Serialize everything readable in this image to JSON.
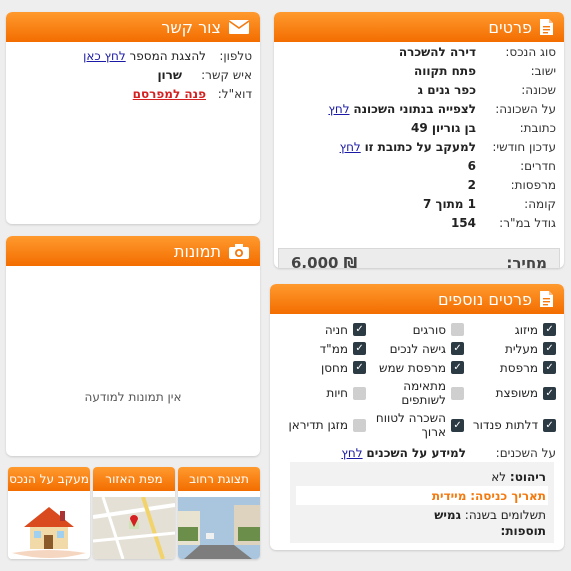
{
  "details": {
    "title": "פרטים",
    "rows": [
      {
        "key": "סוג הנכס:",
        "value": "דירה להשכרה"
      },
      {
        "key": "ישוב:",
        "value": "פתח תקווה"
      },
      {
        "key": "שכונה:",
        "value": "כפר גנים ג"
      },
      {
        "key": "על השכונה:",
        "value": "לצפייה בנתוני השכונה",
        "link": "לחץ"
      },
      {
        "key": "כתובת:",
        "value": "בן גוריון 49"
      },
      {
        "key": "עדכון חודשי:",
        "value": "למעקב על כתובת זו",
        "link": "לחץ"
      },
      {
        "key": "חדרים:",
        "value": "6"
      },
      {
        "key": "מרפסות:",
        "value": "2"
      },
      {
        "key": "קומה:",
        "value": "1 מתוך 7"
      },
      {
        "key": "גודל במ\"ר:",
        "value": "154"
      }
    ],
    "price_label": "מחיר:",
    "price_value": "₪ 6,000"
  },
  "contact": {
    "title": "צור קשר",
    "phone_label": "טלפון:",
    "phone_text": "להצגת המספר",
    "phone_link": "לחץ כאן",
    "person_label": "איש קשר:",
    "person_value": "שרון",
    "email_label": "דוא\"ל:",
    "email_link": "פנה למפרסם"
  },
  "photos": {
    "title": "תמונות",
    "empty_text": "אין תמונות למודעה"
  },
  "more": {
    "title": "פרטים נוספים",
    "features": [
      {
        "label": "מיזוג",
        "checked": true
      },
      {
        "label": "סורגים",
        "checked": false
      },
      {
        "label": "חניה",
        "checked": true
      },
      {
        "label": "מעלית",
        "checked": true
      },
      {
        "label": "גישה לנכים",
        "checked": true
      },
      {
        "label": "ממ\"ד",
        "checked": true
      },
      {
        "label": "מרפסת",
        "checked": true
      },
      {
        "label": "מרפסת שמש",
        "checked": true
      },
      {
        "label": "מחסן",
        "checked": true
      },
      {
        "label": "משופצת",
        "checked": true
      },
      {
        "label": "מתאימה לשותפים",
        "checked": false
      },
      {
        "label": "חיות",
        "checked": false
      },
      {
        "label": "דלתות פנדור",
        "checked": true
      },
      {
        "label": "השכרה לטווח ארוך",
        "checked": true
      },
      {
        "label": "מזגן תדיראן",
        "checked": false
      }
    ],
    "neighbors_label": "על השכנים:",
    "neighbors_text": "למידע על השכנים",
    "neighbors_link": "לחץ",
    "furniture_label": "ריהוט:",
    "furniture_value": "לא",
    "entry_label": "תאריך כניסה:",
    "entry_value": "מיידית",
    "payments_label": "תשלומים בשנה:",
    "payments_value": "גמיש",
    "additions_label": "תוספות:"
  },
  "thumbs": [
    {
      "label": "תצוגת רחוב"
    },
    {
      "label": "מפת האזור"
    },
    {
      "label": "מעקב על הנכס"
    }
  ],
  "colors": {
    "accent": "#f47a10",
    "link": "#1a1aa6",
    "red": "#d42020"
  }
}
